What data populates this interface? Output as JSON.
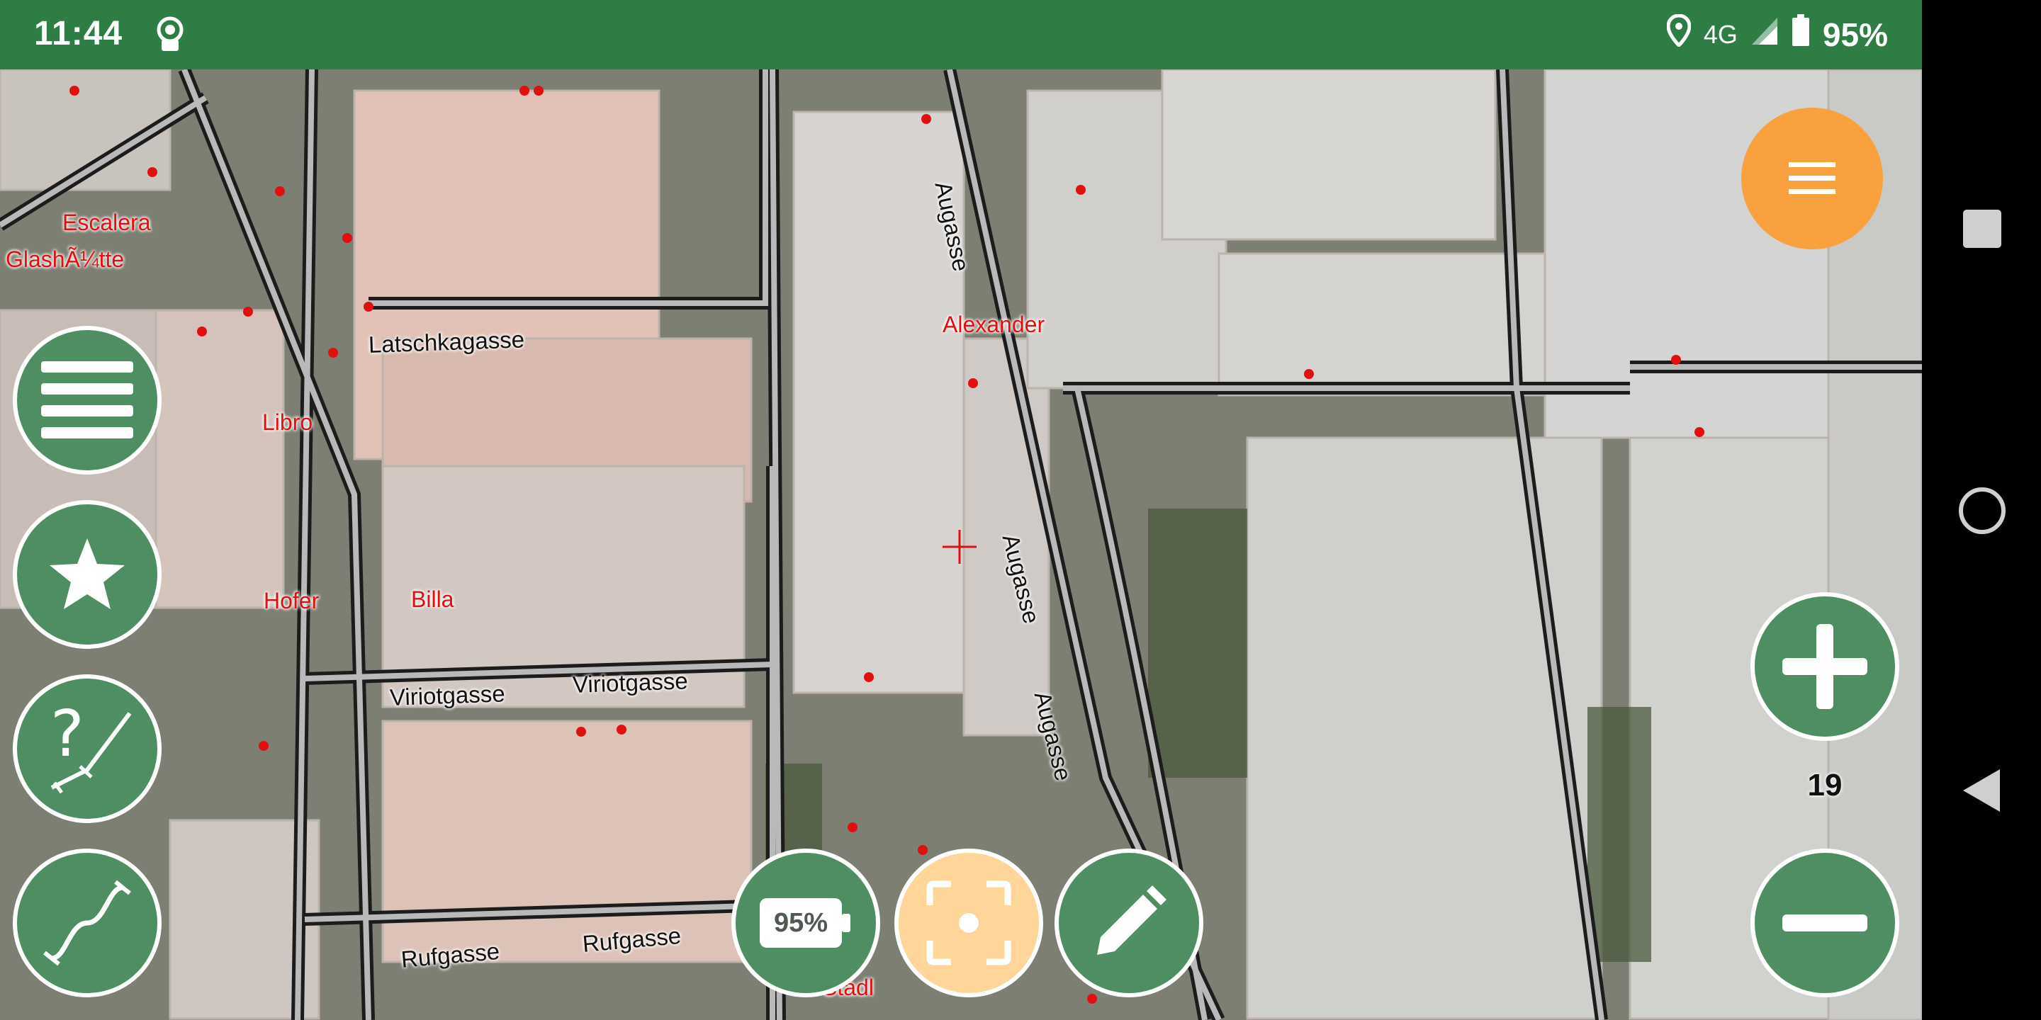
{
  "status_bar": {
    "time": "11:44",
    "network": "4G",
    "battery": "95%"
  },
  "map": {
    "pois": [
      {
        "id": "escalera",
        "label": "Escalera"
      },
      {
        "id": "glashuette",
        "label": "GlashÃ¼tte"
      },
      {
        "id": "libro",
        "label": "Libro"
      },
      {
        "id": "hofer",
        "label": "Hofer"
      },
      {
        "id": "billa",
        "label": "Billa"
      },
      {
        "id": "alexander",
        "label": "Alexander"
      },
      {
        "id": "stadl",
        "label": "Stadl"
      }
    ],
    "streets": [
      {
        "id": "latschkagasse",
        "label": "Latschkagasse"
      },
      {
        "id": "augasse1",
        "label": "Augasse"
      },
      {
        "id": "augasse2",
        "label": "Augasse"
      },
      {
        "id": "augasse3",
        "label": "Augasse"
      },
      {
        "id": "viriotgasse1",
        "label": "Viriotgasse"
      },
      {
        "id": "viriotgasse2",
        "label": "Viriotgasse"
      },
      {
        "id": "rufgasse1",
        "label": "Rufgasse"
      },
      {
        "id": "rufgasse2",
        "label": "Rufgasse"
      }
    ]
  },
  "controls": {
    "battery_button_label": "95%",
    "zoom_level": "19"
  },
  "colors": {
    "status_bar": "#2d7d45",
    "fab_green": "#4e8e62",
    "fab_orange": "#f9a03f",
    "fab_peach": "#ffd59a"
  }
}
